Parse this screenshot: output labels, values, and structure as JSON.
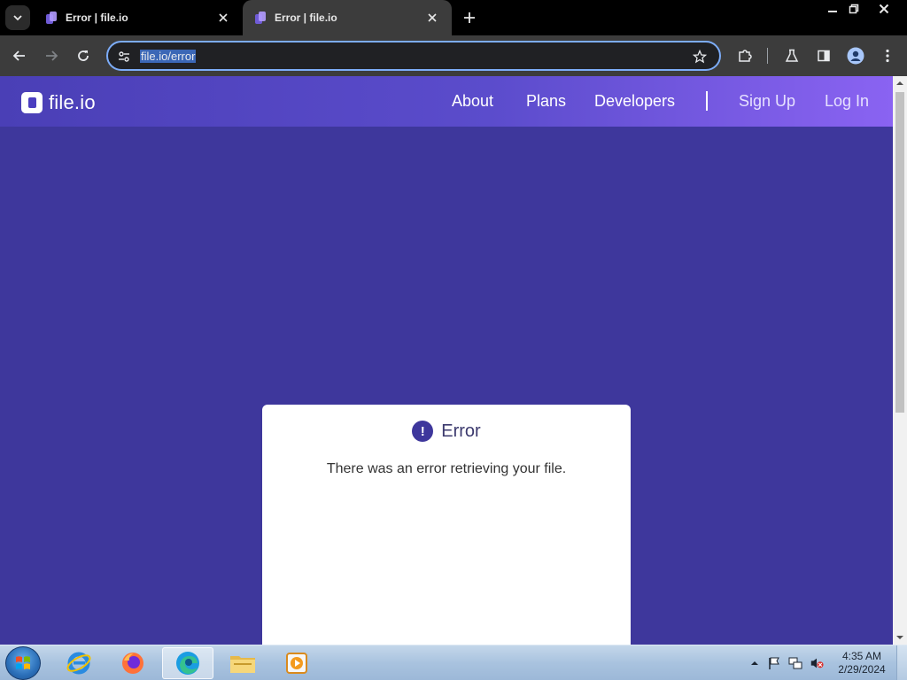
{
  "browser": {
    "tabs": [
      {
        "title": "Error | file.io",
        "active": false
      },
      {
        "title": "Error | file.io",
        "active": true
      }
    ],
    "address_bar": {
      "url": "file.io/error"
    }
  },
  "site": {
    "logo_text": "file.io",
    "nav": {
      "about": "About",
      "plans": "Plans",
      "developers": "Developers",
      "sign_up": "Sign Up",
      "log_in": "Log In"
    },
    "error": {
      "icon_glyph": "!",
      "title": "Error",
      "message": "There was an error retrieving your file."
    }
  },
  "taskbar": {
    "apps": [
      "internet-explorer-icon",
      "firefox-icon",
      "edge-icon",
      "file-explorer-icon",
      "media-player-icon"
    ],
    "clock": {
      "time": "4:35 AM",
      "date": "2/29/2024"
    }
  },
  "colors": {
    "page_bg": "#3e379c",
    "nav_gradient_start": "#4a3fb6",
    "nav_gradient_end": "#8a63f2",
    "card_bg": "#ffffff"
  }
}
